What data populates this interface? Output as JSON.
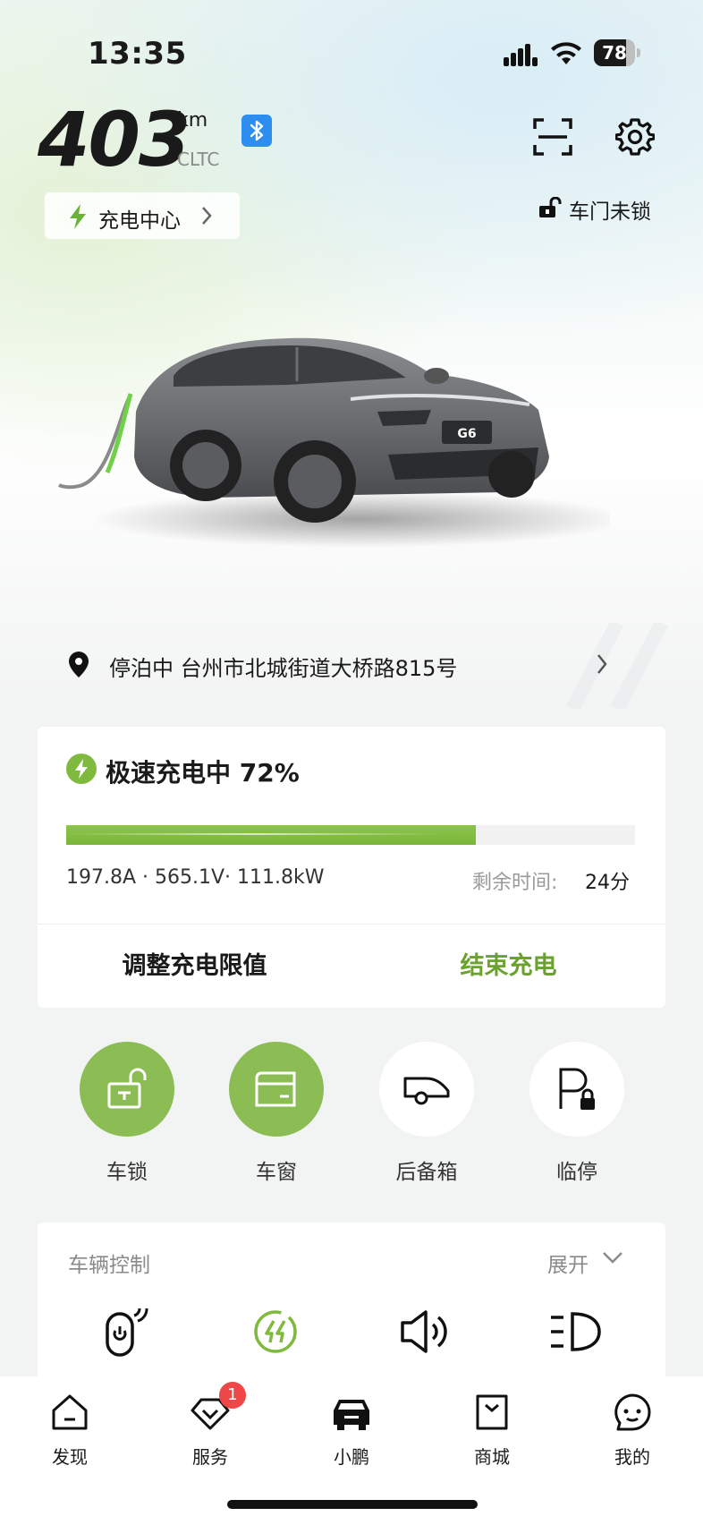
{
  "status_bar": {
    "time": "13:35",
    "battery_level": "78"
  },
  "header": {
    "range_value": "403",
    "range_unit": "km",
    "range_standard": "CLTC",
    "bluetooth_icon": "bluetooth-icon",
    "charge_center_label": "充电中心",
    "door_status": "车门未锁"
  },
  "location": {
    "text": "停泊中 台州市北城街道大桥路815号"
  },
  "charging": {
    "title": "极速充电中 72%",
    "progress_percent": 72,
    "stats": "197.8A · 565.1V· 111.8kW",
    "remaining_label": "剩余时间:",
    "remaining_value": "24分",
    "adjust_limit_label": "调整充电限值",
    "end_charge_label": "结束充电"
  },
  "quick_actions": [
    {
      "label": "车锁",
      "icon": "unlock-icon",
      "active": true
    },
    {
      "label": "车窗",
      "icon": "window-icon",
      "active": true
    },
    {
      "label": "后备箱",
      "icon": "trunk-icon",
      "active": false
    },
    {
      "label": "临停",
      "icon": "parking-lock-icon",
      "active": false
    }
  ],
  "vehicle_control": {
    "title": "车辆控制",
    "expand_label": "展开",
    "controls": [
      "remote-power-icon",
      "fast-charge-icon",
      "horn-icon",
      "headlight-icon"
    ]
  },
  "bottom_nav": [
    {
      "label": "发现",
      "icon": "home-icon"
    },
    {
      "label": "服务",
      "icon": "service-icon",
      "badge": "1"
    },
    {
      "label": "小鹏",
      "icon": "car-icon"
    },
    {
      "label": "商城",
      "icon": "shop-icon"
    },
    {
      "label": "我的",
      "icon": "profile-icon"
    }
  ],
  "colors": {
    "accent_green": "#7fba3f",
    "end_charge_green": "#6aa22e",
    "bluetooth_blue": "#2e8ef0",
    "badge_red": "#ef4747"
  }
}
